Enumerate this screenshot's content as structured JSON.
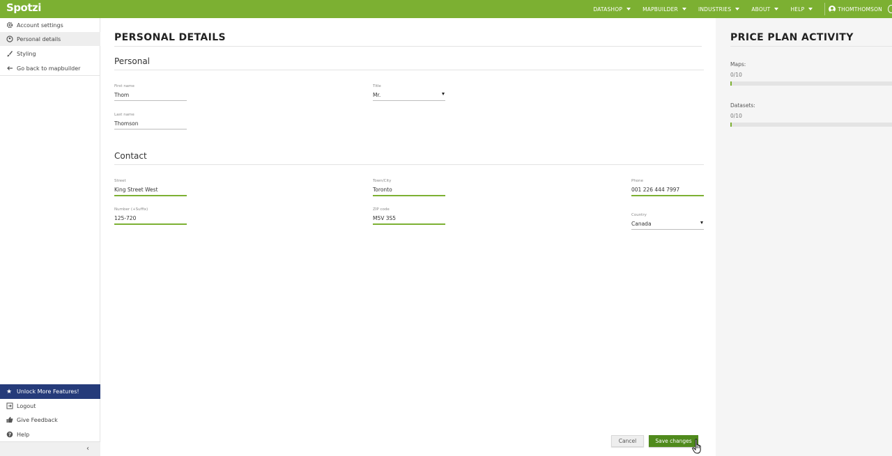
{
  "app": {
    "logo": "Spotzi"
  },
  "topnav": {
    "items": [
      {
        "label": "DATASHOP"
      },
      {
        "label": "MAPBUILDER"
      },
      {
        "label": "INDUSTRIES"
      },
      {
        "label": "ABOUT"
      },
      {
        "label": "HELP"
      }
    ],
    "user": "THOMTHOMSON"
  },
  "sidebar": {
    "items": [
      {
        "label": "Account settings",
        "icon": "gear-icon"
      },
      {
        "label": "Personal details",
        "icon": "user-circle-icon"
      },
      {
        "label": "Styling",
        "icon": "brush-icon"
      },
      {
        "label": "Go back to mapbuilder",
        "icon": "arrow-left-icon"
      }
    ],
    "unlock": {
      "label": "Unlock More Features!",
      "icon": "star-icon"
    },
    "bottom_items": [
      {
        "label": "Logout",
        "icon": "logout-icon"
      },
      {
        "label": "Give Feedback",
        "icon": "thumbs-up-icon"
      },
      {
        "label": "Help",
        "icon": "help-icon"
      }
    ]
  },
  "main": {
    "title": "PERSONAL DETAILS",
    "personal": {
      "heading": "Personal",
      "first_name": {
        "label": "First name",
        "value": "Thom"
      },
      "last_name": {
        "label": "Last name",
        "value": "Thomson"
      },
      "title": {
        "label": "Title",
        "value": "Mr."
      }
    },
    "contact": {
      "heading": "Contact",
      "street": {
        "label": "Street",
        "value": "King Street West"
      },
      "number": {
        "label": "Number (+Suffix)",
        "value": "125-720"
      },
      "town": {
        "label": "Town/City",
        "value": "Toronto"
      },
      "zip": {
        "label": "ZIP code",
        "value": "M5V 3S5"
      },
      "phone": {
        "label": "Phone",
        "value": "001 226 444 7997"
      },
      "country": {
        "label": "Country",
        "value": "Canada"
      }
    },
    "buttons": {
      "cancel": "Cancel",
      "save": "Save changes"
    }
  },
  "price_plan": {
    "title": "PRICE PLAN ACTIVITY",
    "maps": {
      "label": "Maps:",
      "count": "0/10",
      "fraction": 0
    },
    "datasets": {
      "label": "Datasets:",
      "count": "0/10",
      "fraction": 0
    }
  },
  "colors": {
    "brand_green": "#7cb032",
    "save_green": "#4f8a1c",
    "unlock_blue": "#253b7a"
  }
}
